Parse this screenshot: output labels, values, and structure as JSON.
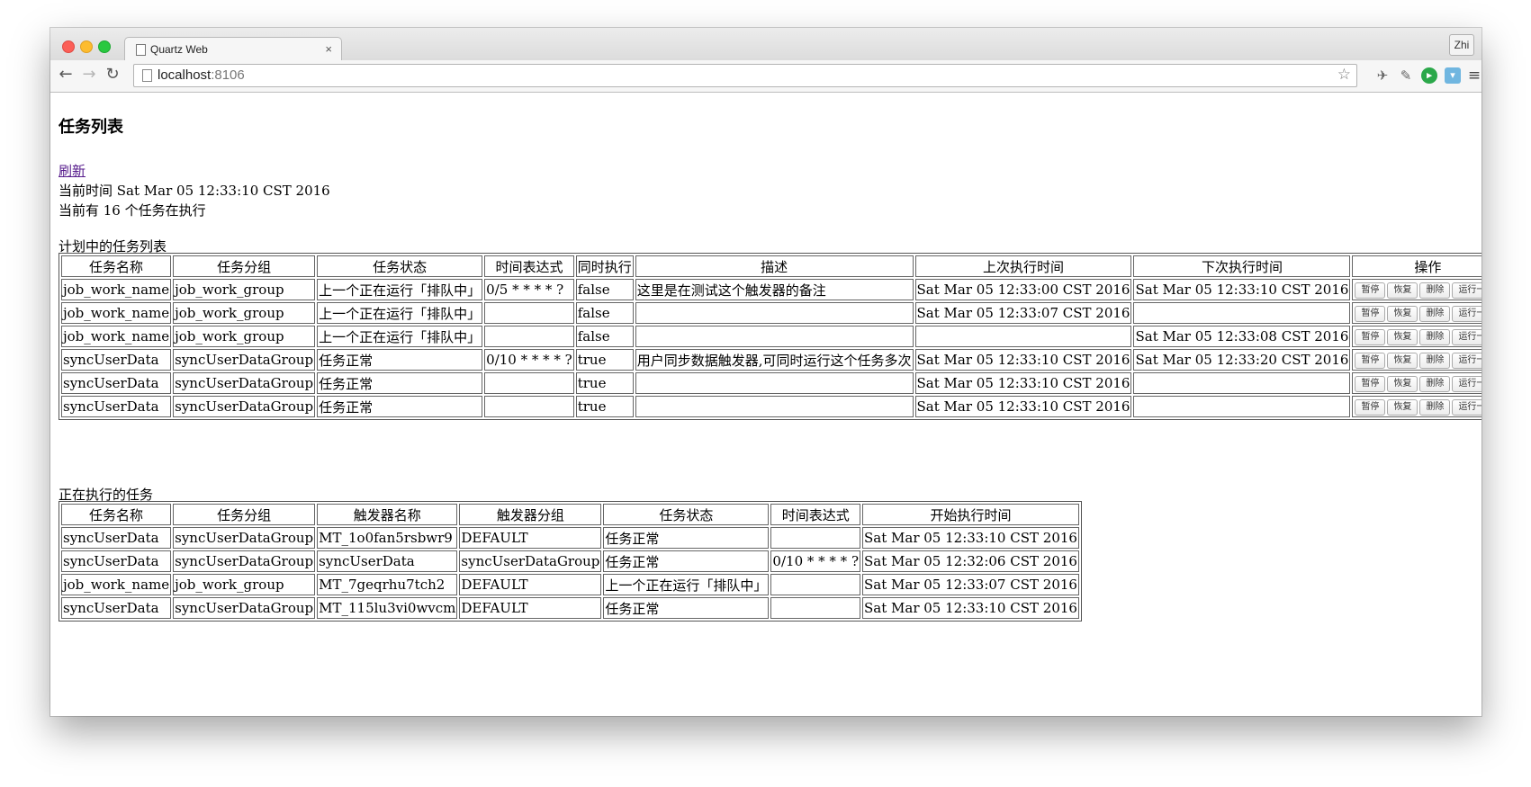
{
  "browser": {
    "tab_title": "Quartz Web",
    "tab_close": "×",
    "profile": "Zhi",
    "url_host": "localhost",
    "url_port": ":8106",
    "icons": [
      "back-icon",
      "forward-icon",
      "reload-icon",
      "page-icon",
      "star-icon",
      "pin-icon",
      "evernote-icon",
      "extension-icon",
      "pocket-icon",
      "menu-icon"
    ]
  },
  "page": {
    "title": "任务列表",
    "refresh_label": "刷新",
    "current_time": "当前时间 Sat Mar 05 12:33:10 CST 2016",
    "current_count": "当前有 16 个任务在执行"
  },
  "planned": {
    "caption": "计划中的任务列表",
    "headers": [
      "任务名称",
      "任务分组",
      "任务状态",
      "时间表达式",
      "同时执行",
      "描述",
      "上次执行时间",
      "下次执行时间",
      "操作"
    ],
    "buttons": [
      "暂停",
      "恢复",
      "删除",
      "运行一次"
    ],
    "rows": [
      [
        "job_work_name",
        "job_work_group",
        "上一个正在运行「排队中」",
        "0/5 * * * * ?",
        "false",
        "这里是在测试这个触发器的备注",
        "Sat Mar 05 12:33:00 CST 2016",
        "Sat Mar 05 12:33:10 CST 2016"
      ],
      [
        "job_work_name",
        "job_work_group",
        "上一个正在运行「排队中」",
        "",
        "false",
        "",
        "Sat Mar 05 12:33:07 CST 2016",
        ""
      ],
      [
        "job_work_name",
        "job_work_group",
        "上一个正在运行「排队中」",
        "",
        "false",
        "",
        "",
        "Sat Mar 05 12:33:08 CST 2016"
      ],
      [
        "syncUserData",
        "syncUserDataGroup",
        "任务正常",
        "0/10 * * * * ?",
        "true",
        "用户同步数据触发器,可同时运行这个任务多次",
        "Sat Mar 05 12:33:10 CST 2016",
        "Sat Mar 05 12:33:20 CST 2016"
      ],
      [
        "syncUserData",
        "syncUserDataGroup",
        "任务正常",
        "",
        "true",
        "",
        "Sat Mar 05 12:33:10 CST 2016",
        ""
      ],
      [
        "syncUserData",
        "syncUserDataGroup",
        "任务正常",
        "",
        "true",
        "",
        "Sat Mar 05 12:33:10 CST 2016",
        ""
      ]
    ]
  },
  "running": {
    "caption": "正在执行的任务",
    "headers": [
      "任务名称",
      "任务分组",
      "触发器名称",
      "触发器分组",
      "任务状态",
      "时间表达式",
      "开始执行时间"
    ],
    "rows": [
      [
        "syncUserData",
        "syncUserDataGroup",
        "MT_1o0fan5rsbwr9",
        "DEFAULT",
        "任务正常",
        "",
        "Sat Mar 05 12:33:10 CST 2016"
      ],
      [
        "syncUserData",
        "syncUserDataGroup",
        "syncUserData",
        "syncUserDataGroup",
        "任务正常",
        "0/10 * * * * ?",
        "Sat Mar 05 12:32:06 CST 2016"
      ],
      [
        "job_work_name",
        "job_work_group",
        "MT_7geqrhu7tch2",
        "DEFAULT",
        "上一个正在运行「排队中」",
        "",
        "Sat Mar 05 12:33:07 CST 2016"
      ],
      [
        "syncUserData",
        "syncUserDataGroup",
        "MT_115lu3vi0wvcm",
        "DEFAULT",
        "任务正常",
        "",
        "Sat Mar 05 12:33:10 CST 2016"
      ]
    ]
  }
}
